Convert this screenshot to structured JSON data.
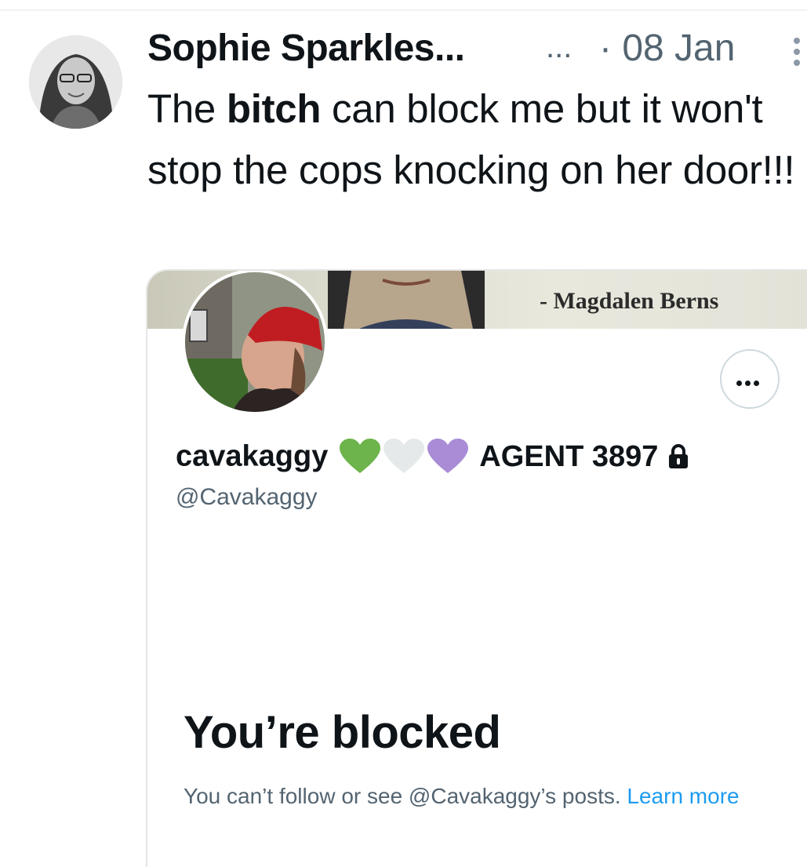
{
  "tweet": {
    "author_name": "Sophie Sparkles...",
    "author_name_suffix": "...",
    "date": "· 08 Jan",
    "text_before": "The ",
    "text_bold": "bitch",
    "text_after": " can block me but it won't stop the cops knocking on her door!!!"
  },
  "card": {
    "banner_quote": "- Magdalen Berns",
    "display_name": "cavakaggy",
    "agent_label": "AGENT 3897",
    "handle": "@Cavakaggy",
    "hearts": [
      "#6cb44b",
      "#e6e9ea",
      "#a98bd6"
    ],
    "blocked_title": "You’re blocked",
    "blocked_desc": "You can’t follow or see @Cavakaggy’s posts.",
    "learn_more": "Learn more"
  },
  "colors": {
    "link": "#1d9bf0",
    "secondary_text": "#536471",
    "primary_text": "#0f1419"
  }
}
